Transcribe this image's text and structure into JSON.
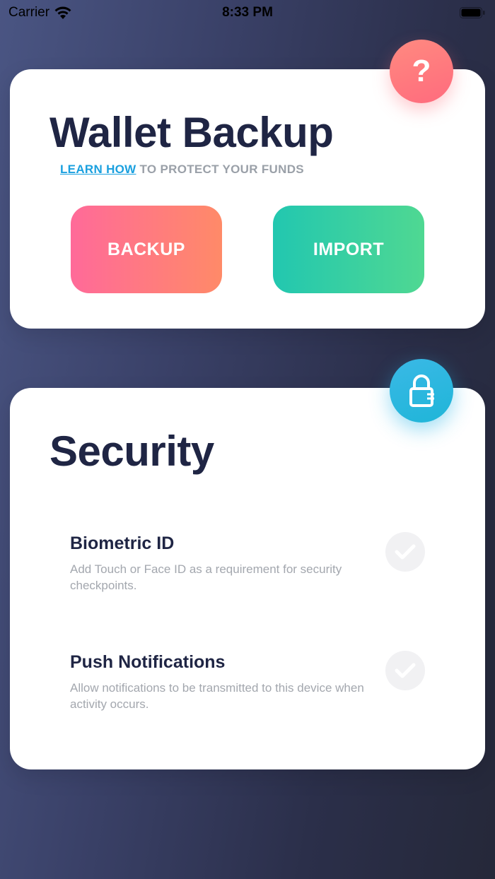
{
  "status_bar": {
    "carrier": "Carrier",
    "time": "8:33 PM"
  },
  "backup_card": {
    "title": "Wallet Backup",
    "subtitle_link": "LEARN HOW",
    "subtitle_rest": " TO PROTECT YOUR FUNDS",
    "help_badge": "?",
    "backup_label": "BACKUP",
    "import_label": "IMPORT"
  },
  "security_card": {
    "title": "Security",
    "settings": [
      {
        "title": "Biometric ID",
        "description": "Add Touch or Face ID as a requirement for security checkpoints.",
        "icon": "check-icon"
      },
      {
        "title": "Push Notifications",
        "description": "Allow notifications to be transmitted to this device when activity occurs.",
        "icon": "check-icon"
      }
    ]
  },
  "colors": {
    "title": "#1f2544",
    "link": "#1aa0df",
    "backup_gradient": [
      "#ff6a99",
      "#ff8a68"
    ],
    "import_gradient": [
      "#22c7b0",
      "#4fd892"
    ],
    "help_badge": "#ff7a80",
    "lock_badge": "#2bb6e0"
  }
}
